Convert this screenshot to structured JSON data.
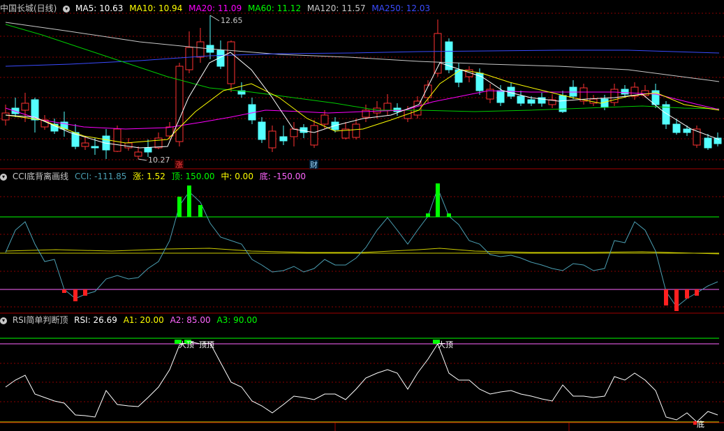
{
  "main": {
    "title": "中国长城(日线)",
    "ma": [
      {
        "label": "MA5: 10.63",
        "color": "#ffffff"
      },
      {
        "label": "MA10: 10.94",
        "color": "#ffff00"
      },
      {
        "label": "MA20: 11.09",
        "color": "#ff00ff"
      },
      {
        "label": "MA60: 11.12",
        "color": "#00ff00"
      },
      {
        "label": "MA120: 11.57",
        "color": "#c8c8c8"
      },
      {
        "label": "MA250: 12.03",
        "color": "#3a4bff"
      }
    ],
    "high_label": "12.65",
    "low_label": "10.27",
    "tag_zhang": "涨",
    "tag_cai": "财"
  },
  "cci": {
    "name": "CCI底背离画线",
    "items": [
      {
        "label": "CCI: -111.85",
        "color": "#4b9fb3"
      },
      {
        "label": "涨: 1.52",
        "color": "#ffff00"
      },
      {
        "label": "顶: 150.00",
        "color": "#00ff00"
      },
      {
        "label": "中: 0.00",
        "color": "#ffff00"
      },
      {
        "label": "底: -150.00",
        "color": "#ff66ff"
      }
    ]
  },
  "rsi": {
    "name": "RSI简单判断顶",
    "items": [
      {
        "label": "RSI: 26.69",
        "color": "#ffffff"
      },
      {
        "label": "A1: 20.00",
        "color": "#ffff00"
      },
      {
        "label": "A2: 85.00",
        "color": "#ff66ff"
      },
      {
        "label": "A3: 90.00",
        "color": "#00ff00"
      }
    ],
    "marks": [
      "大顶",
      "顶顶",
      "大顶",
      "底"
    ]
  },
  "colors": {
    "up": "#ff3232",
    "down": "#54ffff",
    "grid": "#8b0000"
  }
}
